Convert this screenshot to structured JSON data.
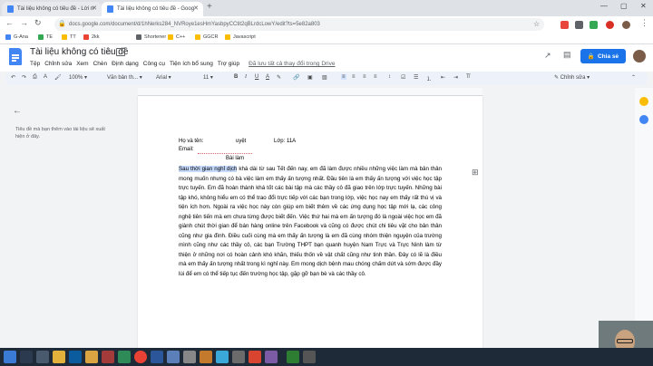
{
  "browser": {
    "tabs": [
      {
        "title": "Tài liệu không có tiêu đề - Lời n",
        "active": false
      },
      {
        "title": "Tài liệu không có tiêu đề - Goog",
        "active": true
      }
    ],
    "url": "docs.google.com/document/d/1hNerks284_NVRoye1esHmYasbpyCCtit2qBLrdcLowY/edit?ts=5e82a803",
    "bookmarks": [
      "G-Ana",
      "TE",
      "TT",
      "2kk",
      "Shortener",
      "C++",
      "GGCR",
      "Javascript"
    ]
  },
  "docs": {
    "title": "Tài liệu không có tiêu đề",
    "menu": [
      "Tệp",
      "Chỉnh sửa",
      "Xem",
      "Chèn",
      "Định dạng",
      "Công cụ",
      "Tiện ích bổ sung",
      "Trợ giúp"
    ],
    "saved_status": "Đã lưu tất cả thay đổi trong Drive",
    "share_label": "Chia sẻ",
    "toolbar": {
      "zoom": "100%",
      "style": "Văn bản th...",
      "font": "Arial",
      "size": "11",
      "bold": "B",
      "italic": "I",
      "underline": "U",
      "text_color": "A",
      "mode": "Chỉnh sửa"
    },
    "outline_hint": "Tiêu đề mà bạn thêm vào tài liệu sẽ xuất hiện ở đây."
  },
  "document": {
    "line1_name_label": "Họ và tên:",
    "line1_name_value": "uyệt",
    "line1_class_label": "Lớp: 11A",
    "line2_email_label": "Email:",
    "heading": "Bài làm",
    "highlight": "Sau thời gian nghỉ dịch",
    "body": " khá dài từ sau Tết đến nay, em đã làm được nhiều những việc làm mà bản thân mong muốn nhưng có bà việc làm em thấy ấn tượng nhất. Đầu tiên là em thấy ấn tượng với việc học tập trực tuyến. Em đã hoàn thành khá tốt các bài tập mà các thầy cô đã giao trên lớp trực tuyến. Những bài tập khó, không hiểu em có thể trao đổi trực tiếp với các bạn trong lớp, việc học nay em thấy rất thú vị và tiện ích hơn. Ngoài ra việc học này còn giúp em biết thêm về các ứng dụng học tập mới lạ, các công nghệ tiên tiến mà em chưa từng được biết đến. Việc thứ hai mà em ấn tượng đó là ngoài việc học em đã giành chút thời gian để bán hàng online trên Facebook và cũng có được chút chi tiêu vặt cho bản thân cũng như gia đình. Điều cuối cùng mà em thấy ấn tượng là em đã cùng nhóm thiện nguyện của trường mình cũng như các thầy cô, các bạn Trường THPT bạn quanh huyện Nam Trực và Trực Ninh làm từ thiện ở những nơi có hoàn cảnh khó khăn, thiếu thốn về vật chất cũng như tinh thần. Đây có lẽ là điều mà em thấy ấn tượng nhất trong kì nghỉ này. Em mong dịch bệnh mau chóng chấm dứt và sớm được đầy lùi để em có thể tiếp tục đến trường học tập, gặp gỡ bạn bè và các thầy cô."
  },
  "colors": {
    "accent": "#1a73e8",
    "highlight": "#c6dafc",
    "taskbar": "#1f2a38"
  }
}
